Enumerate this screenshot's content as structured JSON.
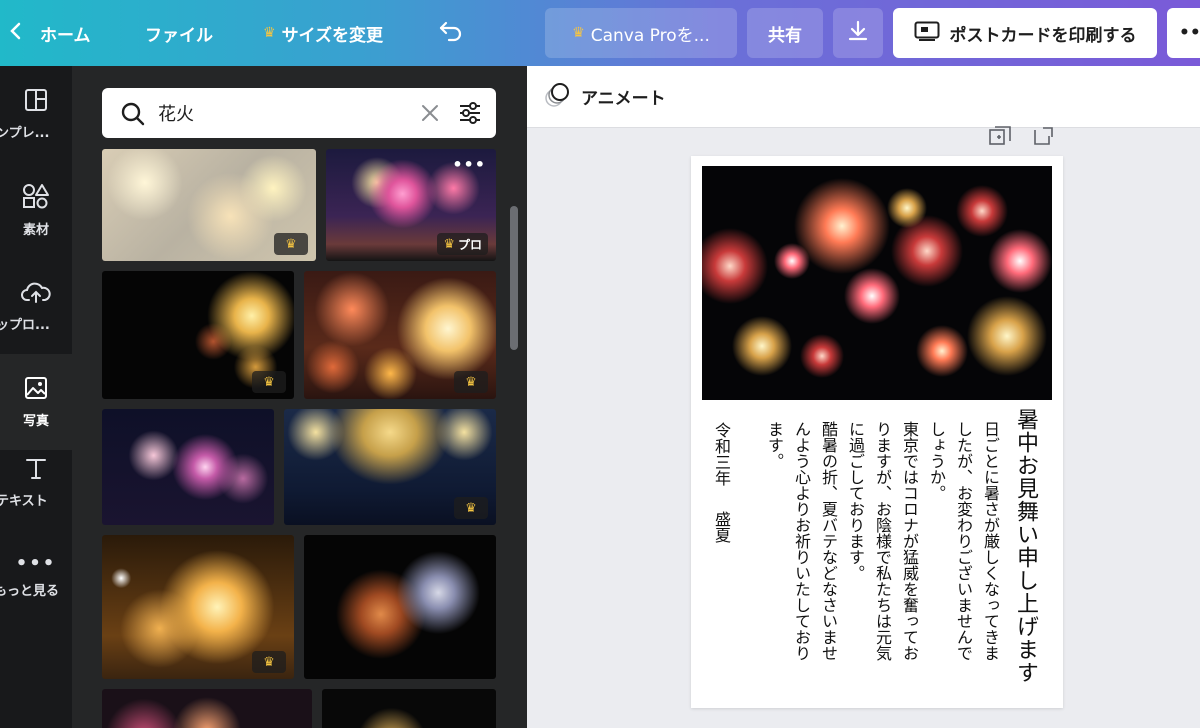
{
  "topbar": {
    "home": "ホーム",
    "file": "ファイル",
    "resize": "サイズを変更",
    "canva_pro": "Canva Proを...",
    "share": "共有",
    "print": "ポストカードを印刷する",
    "more": "•••"
  },
  "rail": {
    "templates": "ンプレ...",
    "elements": "素材",
    "uploads": "ップロ...",
    "photos": "写真",
    "text": "テキスト",
    "more": "もっと見る"
  },
  "search": {
    "value": "花火"
  },
  "thumbs": {
    "pro_label": "プロ"
  },
  "editor": {
    "animate": "アニメート"
  },
  "card": {
    "title": "暑中お見舞い申し上げます",
    "body": [
      "日ごとに暑さが厳しくなってきま",
      "したが、お変わりございませんで",
      "しょうか。",
      "東京ではコロナが猛威を奮ってお",
      "りますが、お陰様で私たちは元気",
      "に過ごしております。",
      "酷暑の折、夏バテなどなさいませ",
      "んよう心よりお祈りいたしており",
      "ます。"
    ],
    "date": "令和三年",
    "season": "盛夏"
  },
  "colors": {
    "gradient_start": "#21b9c9",
    "gradient_end": "#7a5ad8",
    "rail_bg": "#18191b",
    "panel_bg": "#252627",
    "crown": "#f5c542"
  }
}
